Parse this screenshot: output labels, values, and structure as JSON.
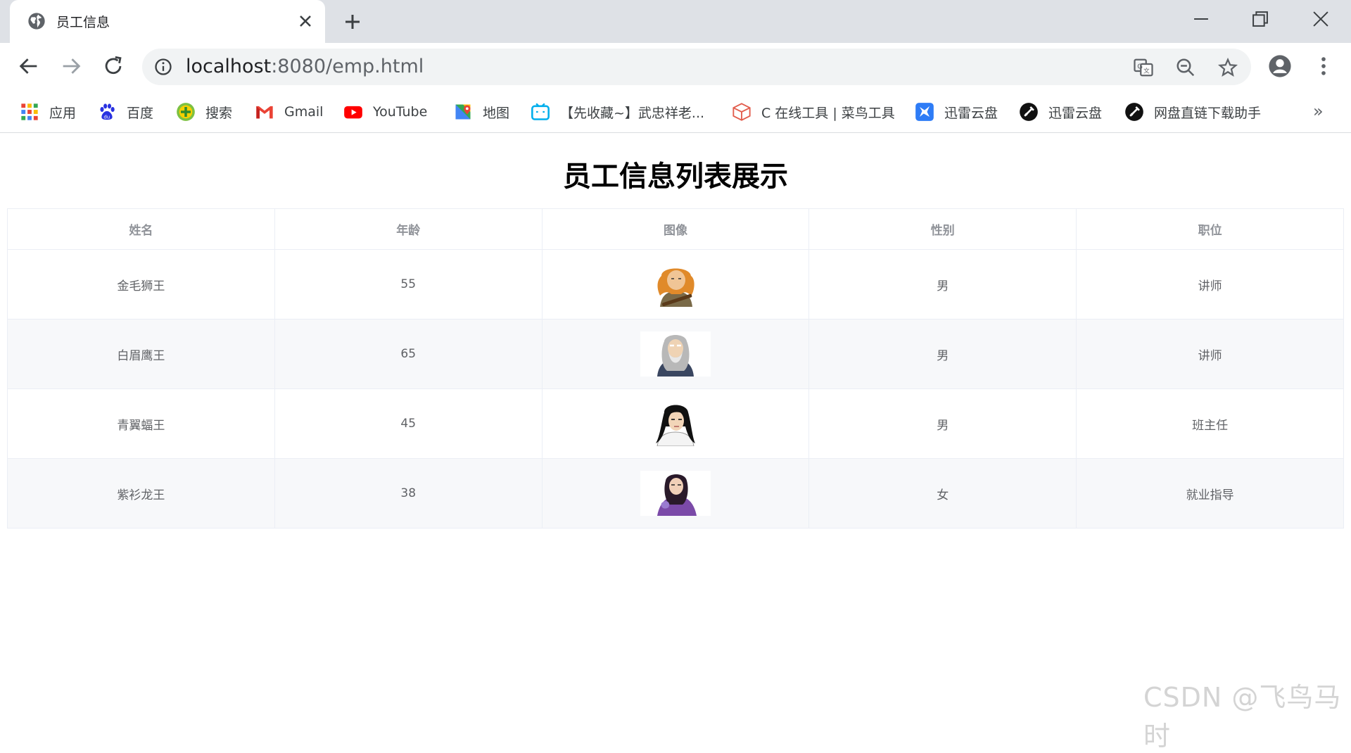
{
  "browser": {
    "tab_title": "员工信息",
    "url_host": "localhost",
    "url_rest": ":8080/emp.html"
  },
  "bookmarks": [
    {
      "label": "应用",
      "icon": "apps-grid-icon"
    },
    {
      "label": "百度",
      "icon": "baidu-icon"
    },
    {
      "label": "搜索",
      "icon": "search-plus-icon"
    },
    {
      "label": "Gmail",
      "icon": "gmail-icon"
    },
    {
      "label": "YouTube",
      "icon": "youtube-icon"
    },
    {
      "label": "地图",
      "icon": "maps-icon"
    },
    {
      "label": "【先收藏~】武忠祥老...",
      "icon": "bilibili-icon"
    },
    {
      "label": "C 在线工具 | 菜鸟工具",
      "icon": "runoob-icon"
    },
    {
      "label": "迅雷云盘",
      "icon": "xunlei-icon"
    },
    {
      "label": "迅雷云盘",
      "icon": "xunlei-dark-icon"
    },
    {
      "label": "网盘直链下载助手",
      "icon": "download-helper-icon"
    }
  ],
  "page": {
    "title": "员工信息列表展示"
  },
  "table": {
    "headers": [
      "姓名",
      "年龄",
      "图像",
      "性别",
      "职位"
    ],
    "rows": [
      {
        "name": "金毛狮王",
        "age": "55",
        "avatar": "avatar-golden-lion",
        "gender": "男",
        "job": "讲师"
      },
      {
        "name": "白眉鹰王",
        "age": "65",
        "avatar": "avatar-white-eagle",
        "gender": "男",
        "job": "讲师"
      },
      {
        "name": "青翼蝠王",
        "age": "45",
        "avatar": "avatar-green-bat",
        "gender": "男",
        "job": "班主任"
      },
      {
        "name": "紫衫龙王",
        "age": "38",
        "avatar": "avatar-purple-dragon",
        "gender": "女",
        "job": "就业指导"
      }
    ]
  },
  "watermark": "CSDN @飞鸟马时",
  "colors": {
    "tabstrip": "#dee1e6",
    "omnibox": "#f1f3f4",
    "table_border": "#ebeef5",
    "stripe": "#f7f8fa",
    "header_text": "#909399",
    "cell_text": "#606266"
  }
}
